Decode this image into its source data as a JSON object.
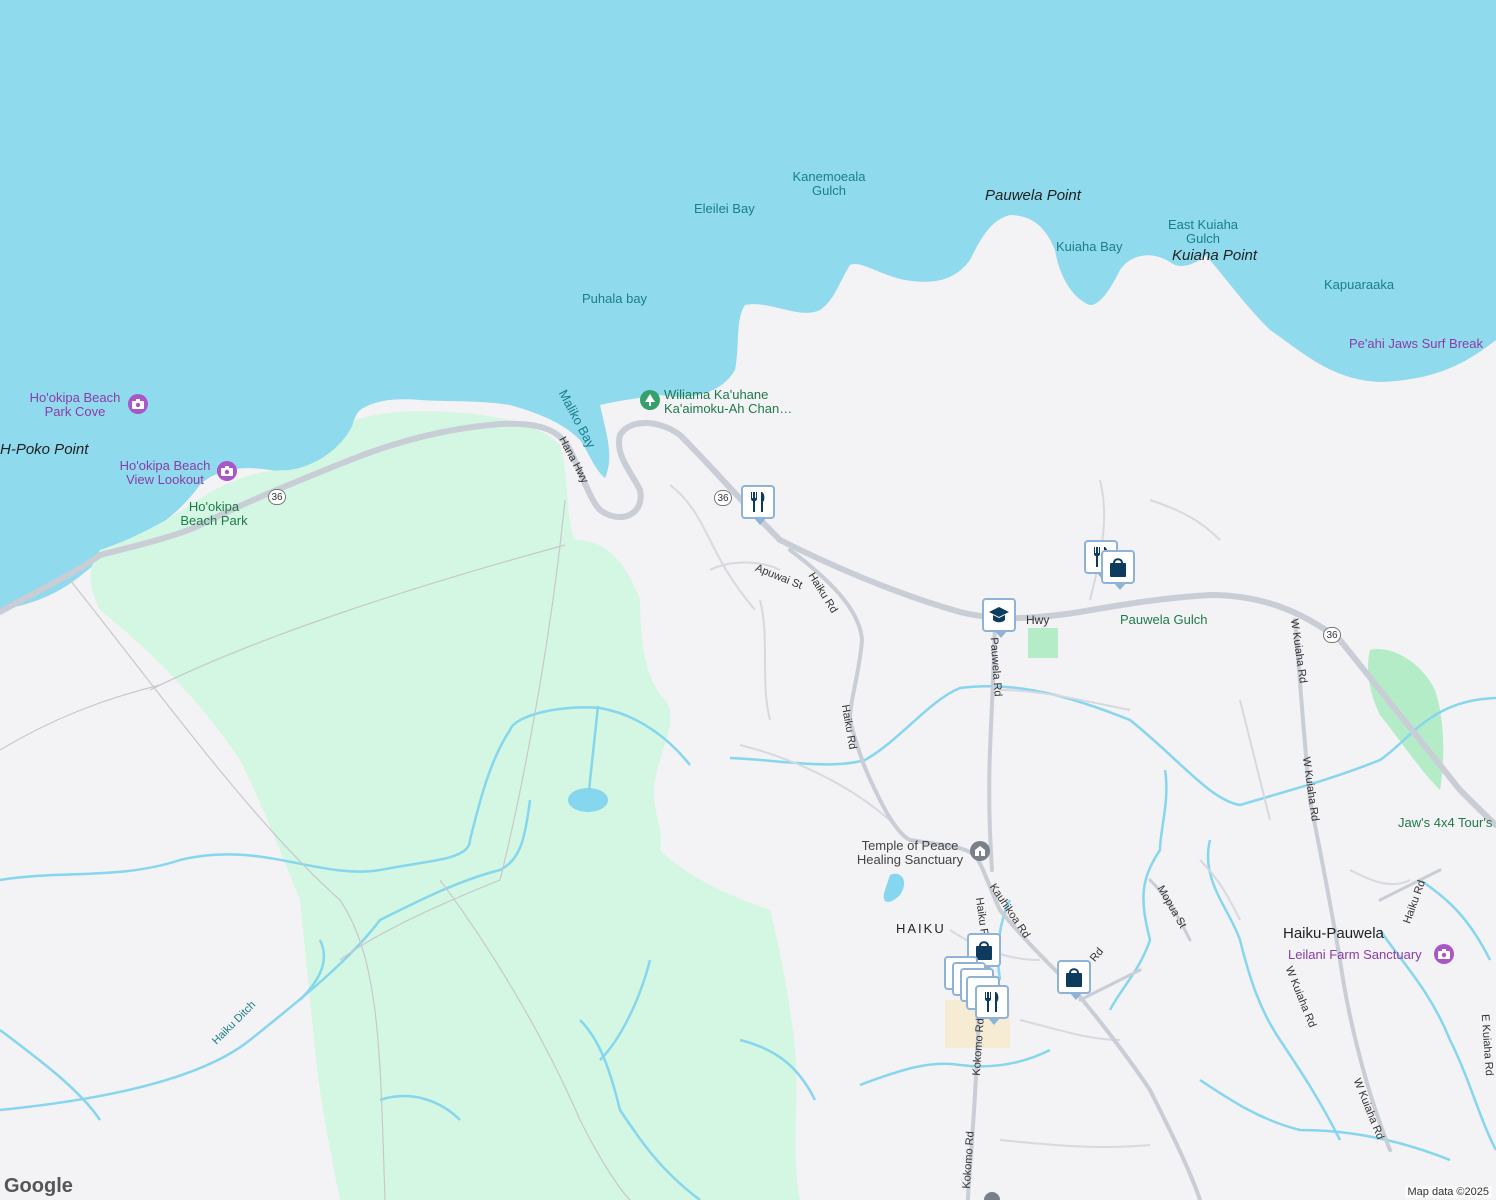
{
  "colors": {
    "ocean": "#8fdaed",
    "land": "#f3f2f4",
    "park": "#d3f7e2",
    "stream": "#85d6ee",
    "road": "#c8cdd6",
    "poi_purple": "#a856c8",
    "park_green": "#34a06a",
    "pin_navy": "#0c3b5e"
  },
  "water_labels": {
    "eleilei_bay": "Eleilei Bay",
    "puhala_bay": "Puhala bay",
    "maliko_bay": "Maliko Bay",
    "kuiaha_bay": "Kuiaha Bay",
    "kapuaraaka": "Kapuaraaka",
    "kanemoeala_gulch": "Kanemoeala Gulch",
    "east_kuiaha_gulch": "East Kuiaha Gulch"
  },
  "point_labels": {
    "pauwela_point": "Pauwela Point",
    "kuiaha_point": "Kuiaha Point",
    "h_poko_point": "H-Poko Point"
  },
  "poi_labels": {
    "hookipa_cove": "Ho'okipa Beach Park Cove",
    "hookipa_lookout": "Ho'okipa Beach View Lookout",
    "peahi_jaws": "Pe'ahi Jaws Surf Break",
    "leilani_farm": "Leilani Farm Sanctuary",
    "jaws_tours": "Jaw's 4x4 Tour's"
  },
  "park_labels": {
    "hookipa_park": "Ho'okipa Beach Park",
    "wiliama": "Wiliama Ka'uhane Ka'aimoku-Ah Chan…",
    "pauwela_gulch": "Pauwela Gulch"
  },
  "place_labels": {
    "temple": "Temple of Peace Healing Sanctuary",
    "haiku": "HAIKU",
    "haiku_pauwela": "Haiku-Pauwela"
  },
  "road_labels": {
    "hana_hwy": "Hana Hwy",
    "hwy": "Hwy",
    "apuwai_st": "Apuwai St",
    "haiku_rd_1": "Haiku Rd",
    "haiku_rd_2": "Haiku Rd",
    "pauwela_rd": "Pauwela Rd",
    "w_kuiaha_rd_1": "W Kuiaha Rd",
    "w_kuiaha_rd_2": "W Kuiaha Rd",
    "w_kuiaha_rd_3": "W Kuiaha Rd",
    "w_kuiaha_rd_4": "W Kuiaha Rd",
    "kauhikoa_rd": "Kauhikoa Rd",
    "kokomo_rd_1": "Kokomo Rd",
    "kokomo_rd_2": "Kokomo Rd",
    "mopua_st": "Mopua St",
    "haiku_rd_3": "Haiku Rd",
    "haiku_rd_4": "Haiku R",
    "e_kuiaha_rd": "E Kuiaha Rd",
    "haiku_ditch": "Haiku Ditch",
    "rd_short": "Rd"
  },
  "route_shields": {
    "r36": "36"
  },
  "pins": [
    {
      "icon": "restaurant-icon"
    },
    {
      "icon": "restaurant-icon"
    },
    {
      "icon": "shopping-bag-icon"
    },
    {
      "icon": "school-icon"
    },
    {
      "icon": "shopping-bag-icon"
    },
    {
      "icon": "shopping-bag-icon"
    },
    {
      "icon": "restaurant-icon"
    }
  ],
  "footer": {
    "logo": "Google",
    "attribution": "Map data ©2025"
  }
}
